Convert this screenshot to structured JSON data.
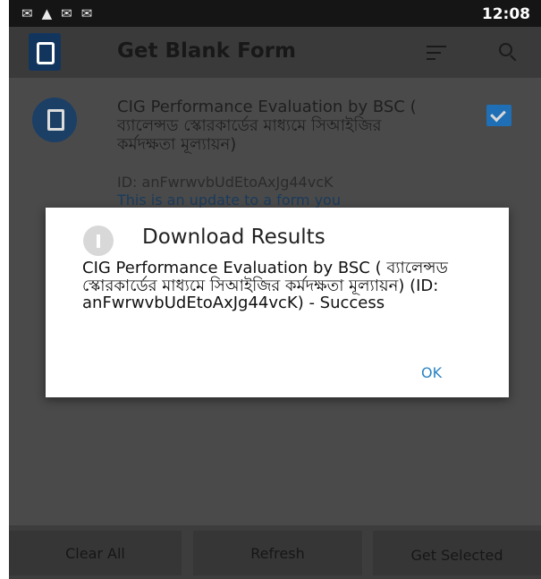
{
  "status_bar": {
    "icons": [
      "gmail-icon",
      "warning-icon",
      "mail-icon",
      "mail-icon"
    ],
    "time": "12:08"
  },
  "toolbar": {
    "title": "Get Blank Form",
    "sort_icon": "sort-icon",
    "search_icon": "search-icon"
  },
  "form_item": {
    "title": "CIG Performance Evaluation by BSC ( ব্যালেন্সড স্কোরকার্ডের মাধ্যমে সিআইজির কর্মদক্ষতা মূল্যায়ন)",
    "id": "ID: anFwrwvbUdEtoAxJg44vcK",
    "update_note": "This is an update to a form you",
    "checked": true
  },
  "bottom_bar": {
    "clear_all": "Clear All",
    "refresh": "Refresh",
    "get_selected": "Get Selected"
  },
  "dialog": {
    "title": "Download Results",
    "message": "CIG Performance Evaluation by BSC ( ব্যালেন্সড স্কোরকার্ডের মাধ্যমে সিআইজির কর্মদক্ষতা মূল্যায়ন) (ID: anFwrwvbUdEtoAxJg44vcK) - Success",
    "ok_label": "OK"
  }
}
